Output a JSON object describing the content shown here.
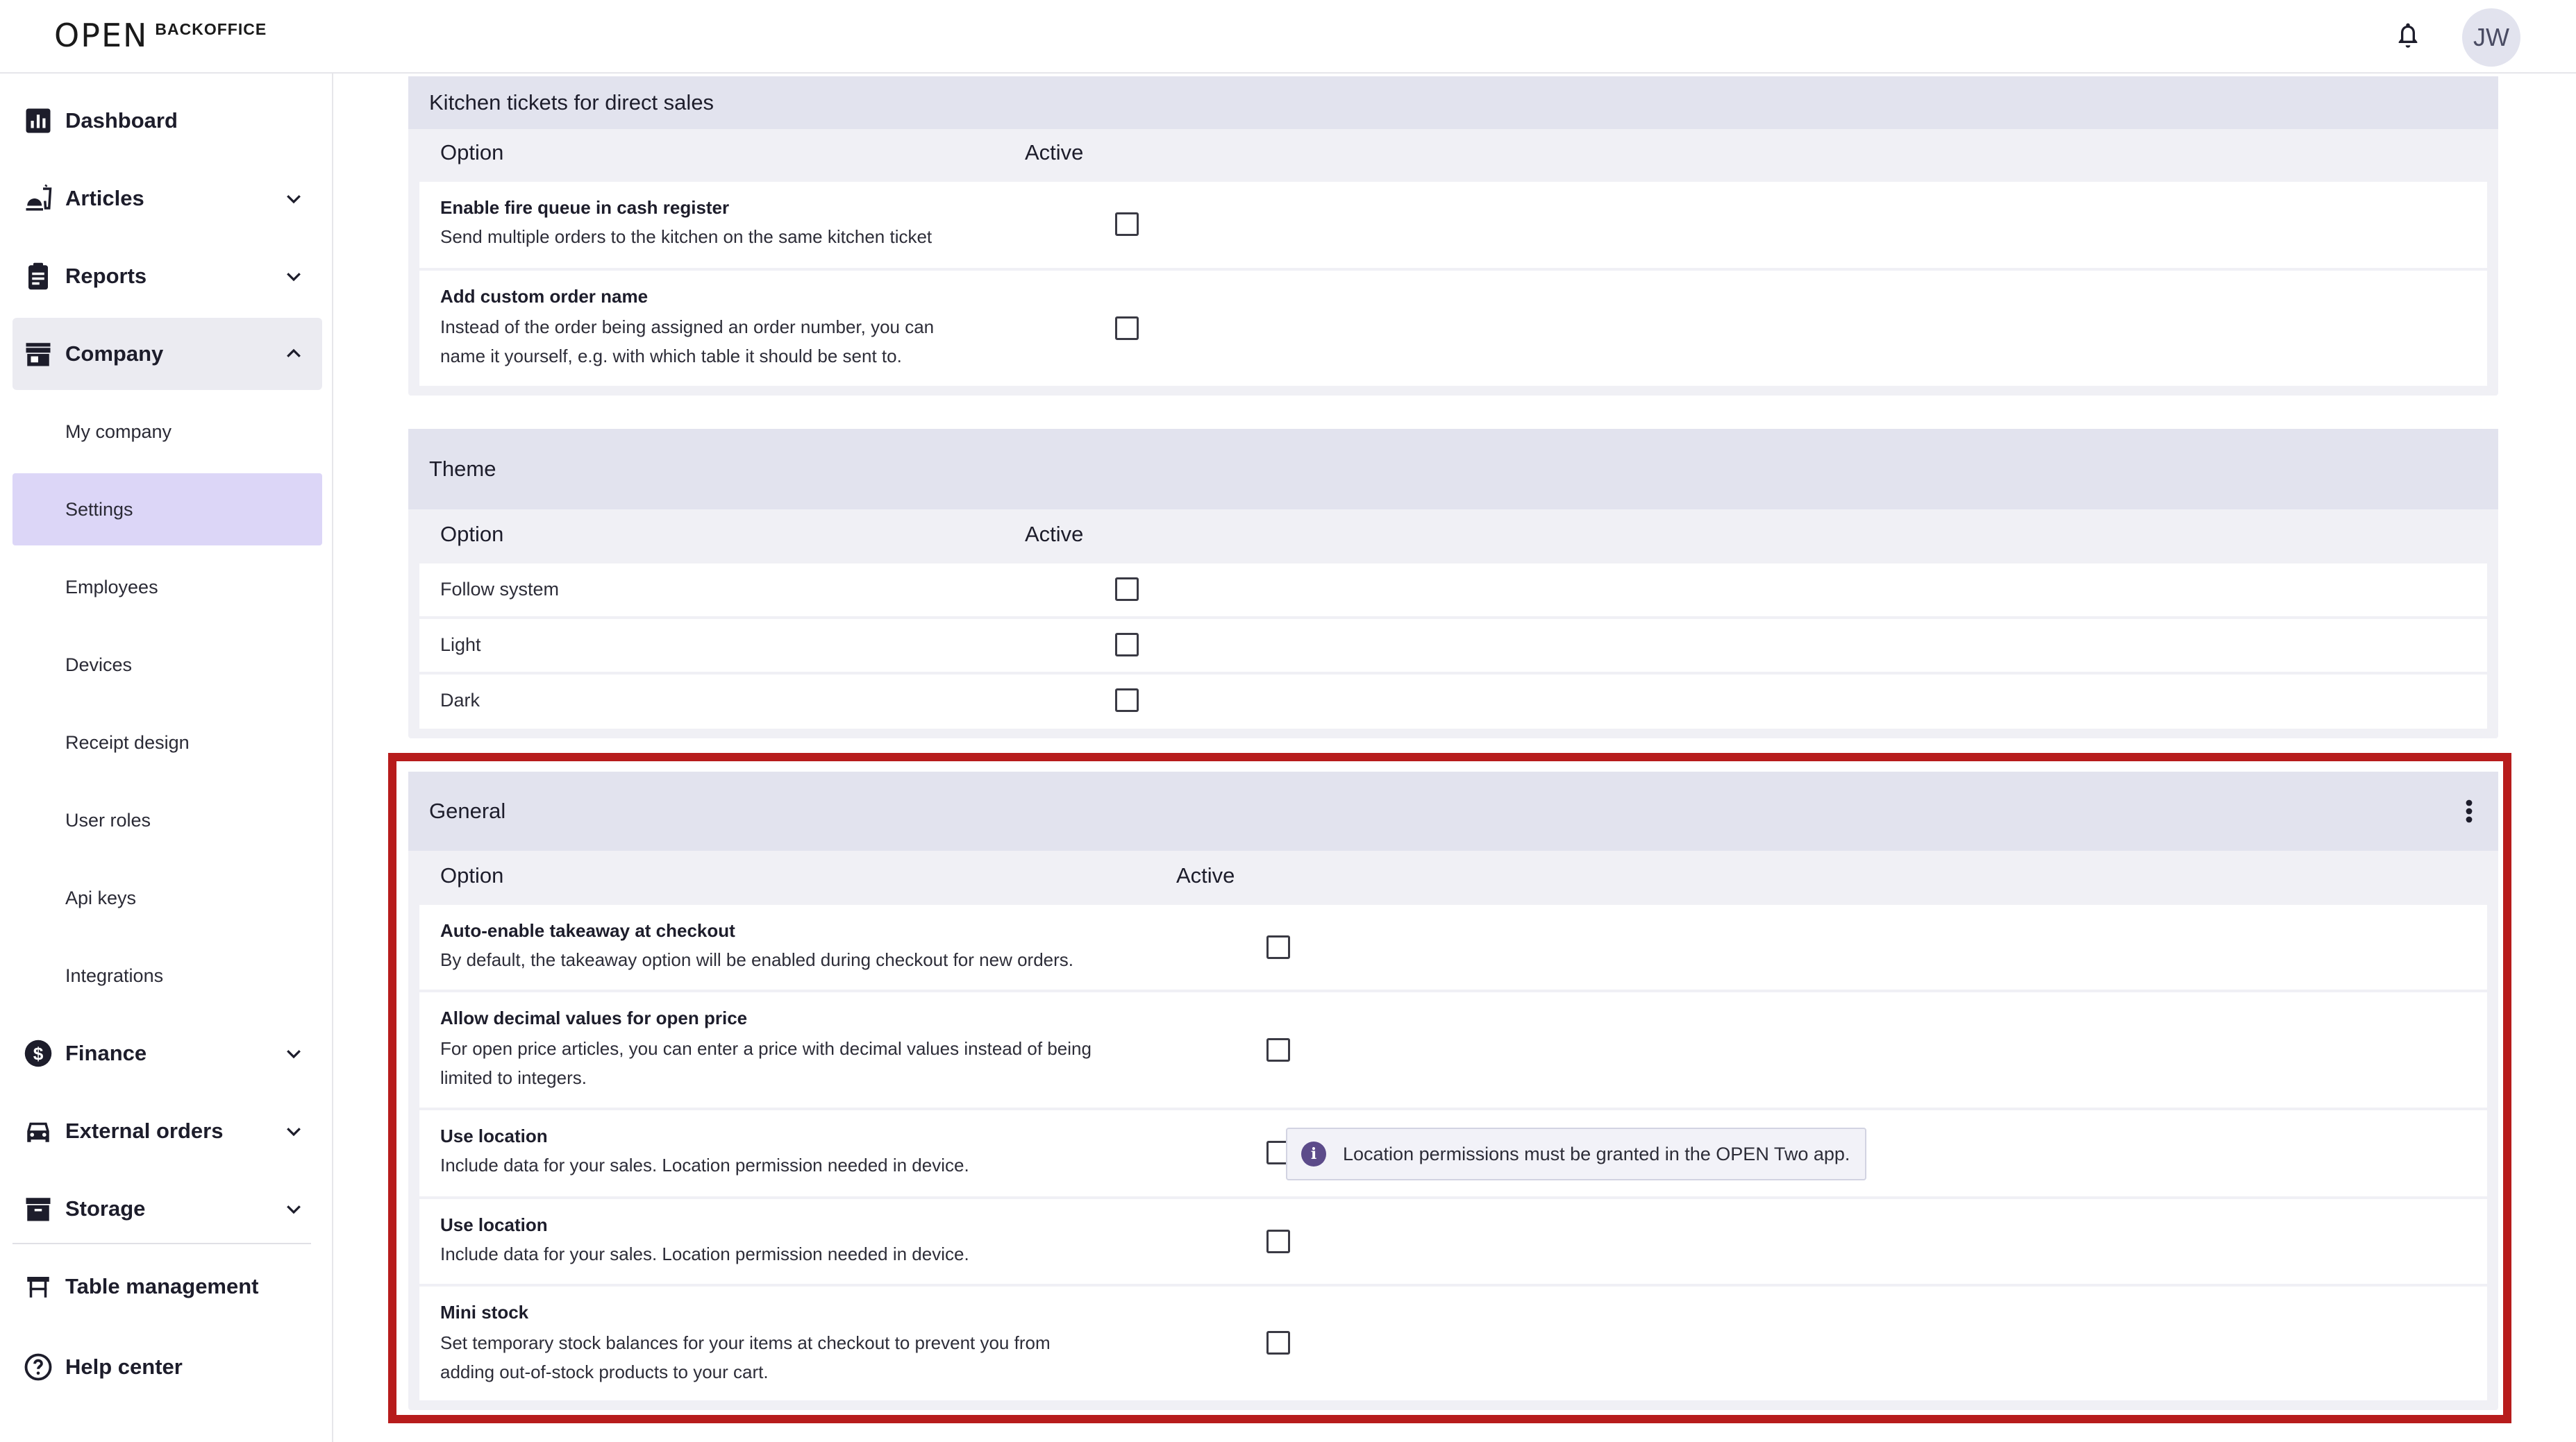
{
  "header": {
    "logo_mark": "OPEN",
    "logo_text": "BACKOFFICE",
    "avatar_initials": "JW"
  },
  "sidebar": {
    "items": [
      {
        "label": "Dashboard",
        "icon": "bar-chart-icon"
      },
      {
        "label": "Articles",
        "icon": "food-icon"
      },
      {
        "label": "Reports",
        "icon": "clipboard-icon"
      },
      {
        "label": "Company",
        "icon": "store-icon"
      },
      {
        "label": "Finance",
        "icon": "dollar-icon"
      },
      {
        "label": "External orders",
        "icon": "car-icon"
      },
      {
        "label": "Storage",
        "icon": "archive-icon"
      },
      {
        "label": "Table management",
        "icon": "table-icon"
      },
      {
        "label": "Help center",
        "icon": "help-icon"
      }
    ],
    "company_sub": [
      "My company",
      "Settings",
      "Employees",
      "Devices",
      "Receipt design",
      "User roles",
      "Api keys",
      "Integrations"
    ],
    "selected": "Settings"
  },
  "kitchen": {
    "title": "Kitchen tickets for direct sales",
    "col_option": "Option",
    "col_active": "Active",
    "rows": [
      {
        "title": "Enable fire queue in cash register",
        "desc": "Send multiple orders to the kitchen on the same kitchen ticket",
        "active": false
      },
      {
        "title": "Add custom order name",
        "desc1": "Instead of the order being assigned an order number, you can",
        "desc2": "name it yourself, e.g. with which table it should be sent to.",
        "active": false
      }
    ]
  },
  "theme": {
    "title": "Theme",
    "col_option": "Option",
    "col_active": "Active",
    "rows": [
      {
        "label": "Follow system",
        "active": false
      },
      {
        "label": "Light",
        "active": false
      },
      {
        "label": "Dark",
        "active": false
      }
    ]
  },
  "general": {
    "title": "General",
    "col_option": "Option",
    "col_active": "Active",
    "rows": [
      {
        "title": "Auto-enable takeaway at checkout",
        "desc": "By default, the takeaway option will be enabled during checkout for new orders.",
        "active": false
      },
      {
        "title": "Allow decimal values for open price",
        "desc1": "For open price articles, you can enter a price with decimal values instead of being",
        "desc2": "limited to integers.",
        "active": false
      },
      {
        "title": "Use location",
        "desc": "Include data for your sales. Location permission needed in device.",
        "active": false
      },
      {
        "title": "Use location",
        "desc": "Include data for your sales. Location permission needed in device.",
        "active": false
      },
      {
        "title": "Mini stock",
        "desc1": "Set temporary stock balances for your items at checkout to prevent you from",
        "desc2": "adding out-of-stock products to your cart.",
        "active": false
      }
    ],
    "info_icon": "i",
    "info_text": "Location permissions must be granted in the OPEN Two app."
  },
  "colors": {
    "selected_bg": "#dcd6f7",
    "section_header_bg": "#e2e3ee",
    "highlight_border": "#b71c1c",
    "info_icon_bg": "#5c4b8a"
  }
}
